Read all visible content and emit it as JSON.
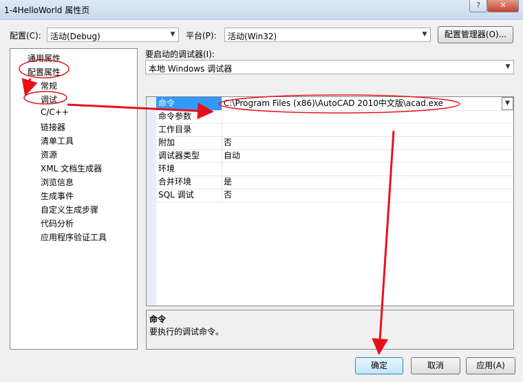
{
  "window": {
    "title": "1-4HelloWorld 属性页",
    "help_glyph": "?",
    "close_glyph": "✕"
  },
  "toolbar": {
    "config_label": "配置(C):",
    "config_value": "活动(Debug)",
    "platform_label": "平台(P):",
    "platform_value": "活动(Win32)",
    "config_manager_button": "配置管理器(O)..."
  },
  "tree": {
    "items": [
      {
        "label": "通用属性",
        "level": 0
      },
      {
        "label": "配置属性",
        "level": 0
      },
      {
        "label": "常规",
        "level": 1
      },
      {
        "label": "调试",
        "level": 1
      },
      {
        "label": "C/C++",
        "level": 1
      },
      {
        "label": "链接器",
        "level": 1
      },
      {
        "label": "清单工具",
        "level": 1
      },
      {
        "label": "资源",
        "level": 1
      },
      {
        "label": "XML 文档生成器",
        "level": 1
      },
      {
        "label": "浏览信息",
        "level": 1
      },
      {
        "label": "生成事件",
        "level": 1
      },
      {
        "label": "自定义生成步骤",
        "level": 1
      },
      {
        "label": "代码分析",
        "level": 1
      },
      {
        "label": "应用程序验证工具",
        "level": 1
      }
    ]
  },
  "debugger": {
    "label": "要启动的调试器(I):",
    "value": "本地 Windows 调试器"
  },
  "properties": {
    "rows": [
      {
        "name": "命令",
        "value": "C:\\Program Files (x86)\\AutoCAD 2010中文版\\acad.exe"
      },
      {
        "name": "命令参数",
        "value": ""
      },
      {
        "name": "工作目录",
        "value": ""
      },
      {
        "name": "附加",
        "value": "否"
      },
      {
        "name": "调试器类型",
        "value": "自动"
      },
      {
        "name": "环境",
        "value": ""
      },
      {
        "name": "合并环境",
        "value": "是"
      },
      {
        "name": "SQL 调试",
        "value": "否"
      }
    ]
  },
  "description": {
    "title": "命令",
    "text": "要执行的调试命令。"
  },
  "buttons": {
    "ok": "确定",
    "cancel": "取消",
    "apply": "应用(A)"
  },
  "colors": {
    "annotation": "#e8101a",
    "selection": "#3399ff"
  }
}
